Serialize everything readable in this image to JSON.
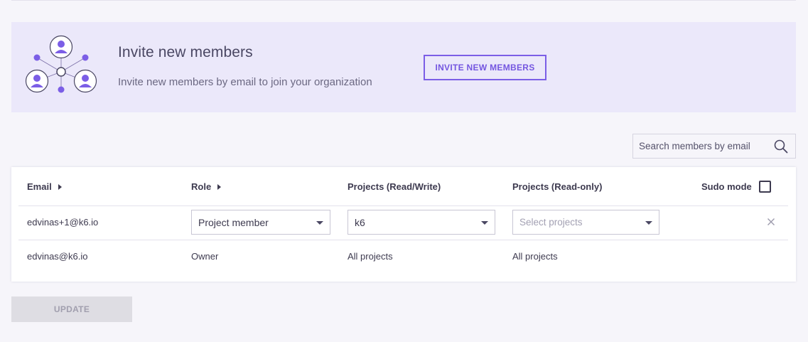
{
  "invite": {
    "title": "Invite new members",
    "description": "Invite new members by email to join your organization",
    "button_label": "INVITE NEW MEMBERS"
  },
  "search": {
    "placeholder": "Search members by email",
    "icon": "search-icon"
  },
  "table": {
    "headers": {
      "email": "Email",
      "role": "Role",
      "projects_rw": "Projects (Read/Write)",
      "projects_ro": "Projects (Read-only)",
      "sudo": "Sudo mode"
    },
    "rows": [
      {
        "email": "edvinas+1@k6.io",
        "role": "Project member",
        "projects_rw": "k6",
        "projects_ro_placeholder": "Select projects"
      },
      {
        "email": "edvinas@k6.io",
        "role": "Owner",
        "projects_rw": "All projects",
        "projects_ro": "All projects"
      }
    ]
  },
  "update_button": "UPDATE",
  "colors": {
    "accent": "#7b5ee6",
    "banner_bg": "#ebe8fa",
    "page_bg": "#f6f5fa",
    "disabled_button": "#dedde3"
  }
}
